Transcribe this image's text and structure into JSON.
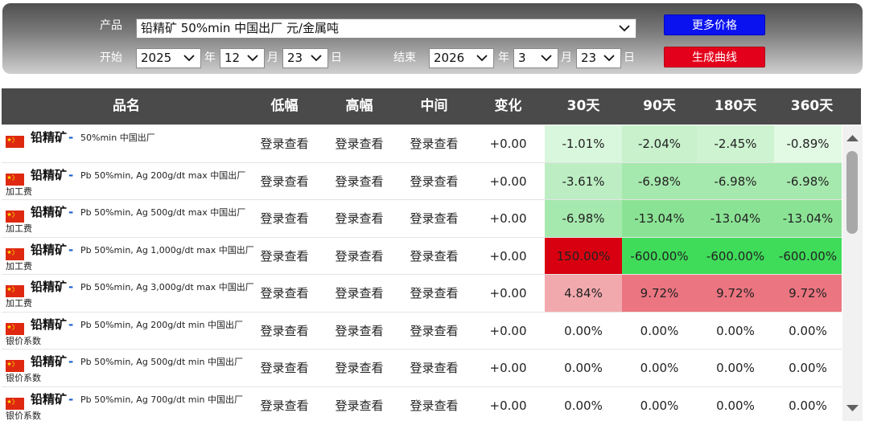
{
  "filters": {
    "product_label": "产品",
    "product_value": "铅精矿 50%min 中国出厂 元/金属吨",
    "start_label": "开始",
    "end_label": "结束",
    "start_year": "2025",
    "start_month": "12",
    "start_day": "23",
    "end_year": "2026",
    "end_month": "3",
    "end_day": "23",
    "year_unit": "年",
    "month_unit": "月",
    "day_unit": "日",
    "more_prices_button": "更多价格",
    "generate_chart_button": "生成曲线"
  },
  "table": {
    "headers": [
      "品名",
      "低幅",
      "高幅",
      "中间",
      "变化",
      "30天",
      "90天",
      "180天",
      "360天"
    ],
    "rows": [
      {
        "name": "铅精矿",
        "desc": "50%min 中国出厂",
        "desc2": "",
        "low": "登录查看",
        "high": "登录查看",
        "mid": "登录查看",
        "change": "+0.00",
        "d30": "-1.01%",
        "d90": "-2.04%",
        "d180": "-2.45%",
        "d360": "-0.89%"
      },
      {
        "name": "铅精矿",
        "desc": "Pb 50%min, Ag 200g/dt max 中国出厂",
        "desc2": "加工费",
        "low": "登录查看",
        "high": "登录查看",
        "mid": "登录查看",
        "change": "+0.00",
        "d30": "-3.61%",
        "d90": "-6.98%",
        "d180": "-6.98%",
        "d360": "-6.98%"
      },
      {
        "name": "铅精矿",
        "desc": "Pb 50%min, Ag 500g/dt max 中国出厂",
        "desc2": "加工费",
        "low": "登录查看",
        "high": "登录查看",
        "mid": "登录查看",
        "change": "+0.00",
        "d30": "-6.98%",
        "d90": "-13.04%",
        "d180": "-13.04%",
        "d360": "-13.04%"
      },
      {
        "name": "铅精矿",
        "desc": "Pb 50%min, Ag 1,000g/dt max 中国出厂",
        "desc2": "加工费",
        "low": "登录查看",
        "high": "登录查看",
        "mid": "登录查看",
        "change": "+0.00",
        "d30": "150.00%",
        "d90": "-600.00%",
        "d180": "-600.00%",
        "d360": "-600.00%"
      },
      {
        "name": "铅精矿",
        "desc": "Pb 50%min, Ag 3,000g/dt max 中国出厂",
        "desc2": "加工费",
        "low": "登录查看",
        "high": "登录查看",
        "mid": "登录查看",
        "change": "+0.00",
        "d30": "4.84%",
        "d90": "9.72%",
        "d180": "9.72%",
        "d360": "9.72%"
      },
      {
        "name": "铅精矿",
        "desc": "Pb 50%min, Ag 200g/dt min 中国出厂",
        "desc2": "银价系数",
        "low": "登录查看",
        "high": "登录查看",
        "mid": "登录查看",
        "change": "+0.00",
        "d30": "0.00%",
        "d90": "0.00%",
        "d180": "0.00%",
        "d360": "0.00%"
      },
      {
        "name": "铅精矿",
        "desc": "Pb 50%min, Ag 500g/dt min 中国出厂",
        "desc2": "银价系数",
        "low": "登录查看",
        "high": "登录查看",
        "mid": "登录查看",
        "change": "+0.00",
        "d30": "0.00%",
        "d90": "0.00%",
        "d180": "0.00%",
        "d360": "0.00%"
      },
      {
        "name": "铅精矿",
        "desc": "Pb 50%min, Ag 700g/dt min 中国出厂",
        "desc2": "银价系数",
        "low": "登录查看",
        "high": "登录查看",
        "mid": "登录查看",
        "change": "+0.00",
        "d30": "0.00%",
        "d90": "0.00%",
        "d180": "0.00%",
        "d360": "0.00%"
      }
    ],
    "cell_colors": [
      [
        "#d9f7dc",
        "#c8f1cc",
        "#cdf3d1",
        "#e2f9e4"
      ],
      [
        "#bdeec3",
        "#a6e9ae",
        "#a6e9ae",
        "#a6e9ae"
      ],
      [
        "#a6e9ae",
        "#8ae394",
        "#8ae394",
        "#8ae394"
      ],
      [
        "#d80010",
        "#3fdc59",
        "#3fdc59",
        "#3fdc59"
      ],
      [
        "#f2a9ad",
        "#eb7580",
        "#eb7580",
        "#eb7580"
      ],
      [
        "",
        "",
        "",
        ""
      ],
      [
        "",
        "",
        "",
        ""
      ],
      [
        "",
        "",
        "",
        ""
      ]
    ],
    "name_dash": "-"
  }
}
